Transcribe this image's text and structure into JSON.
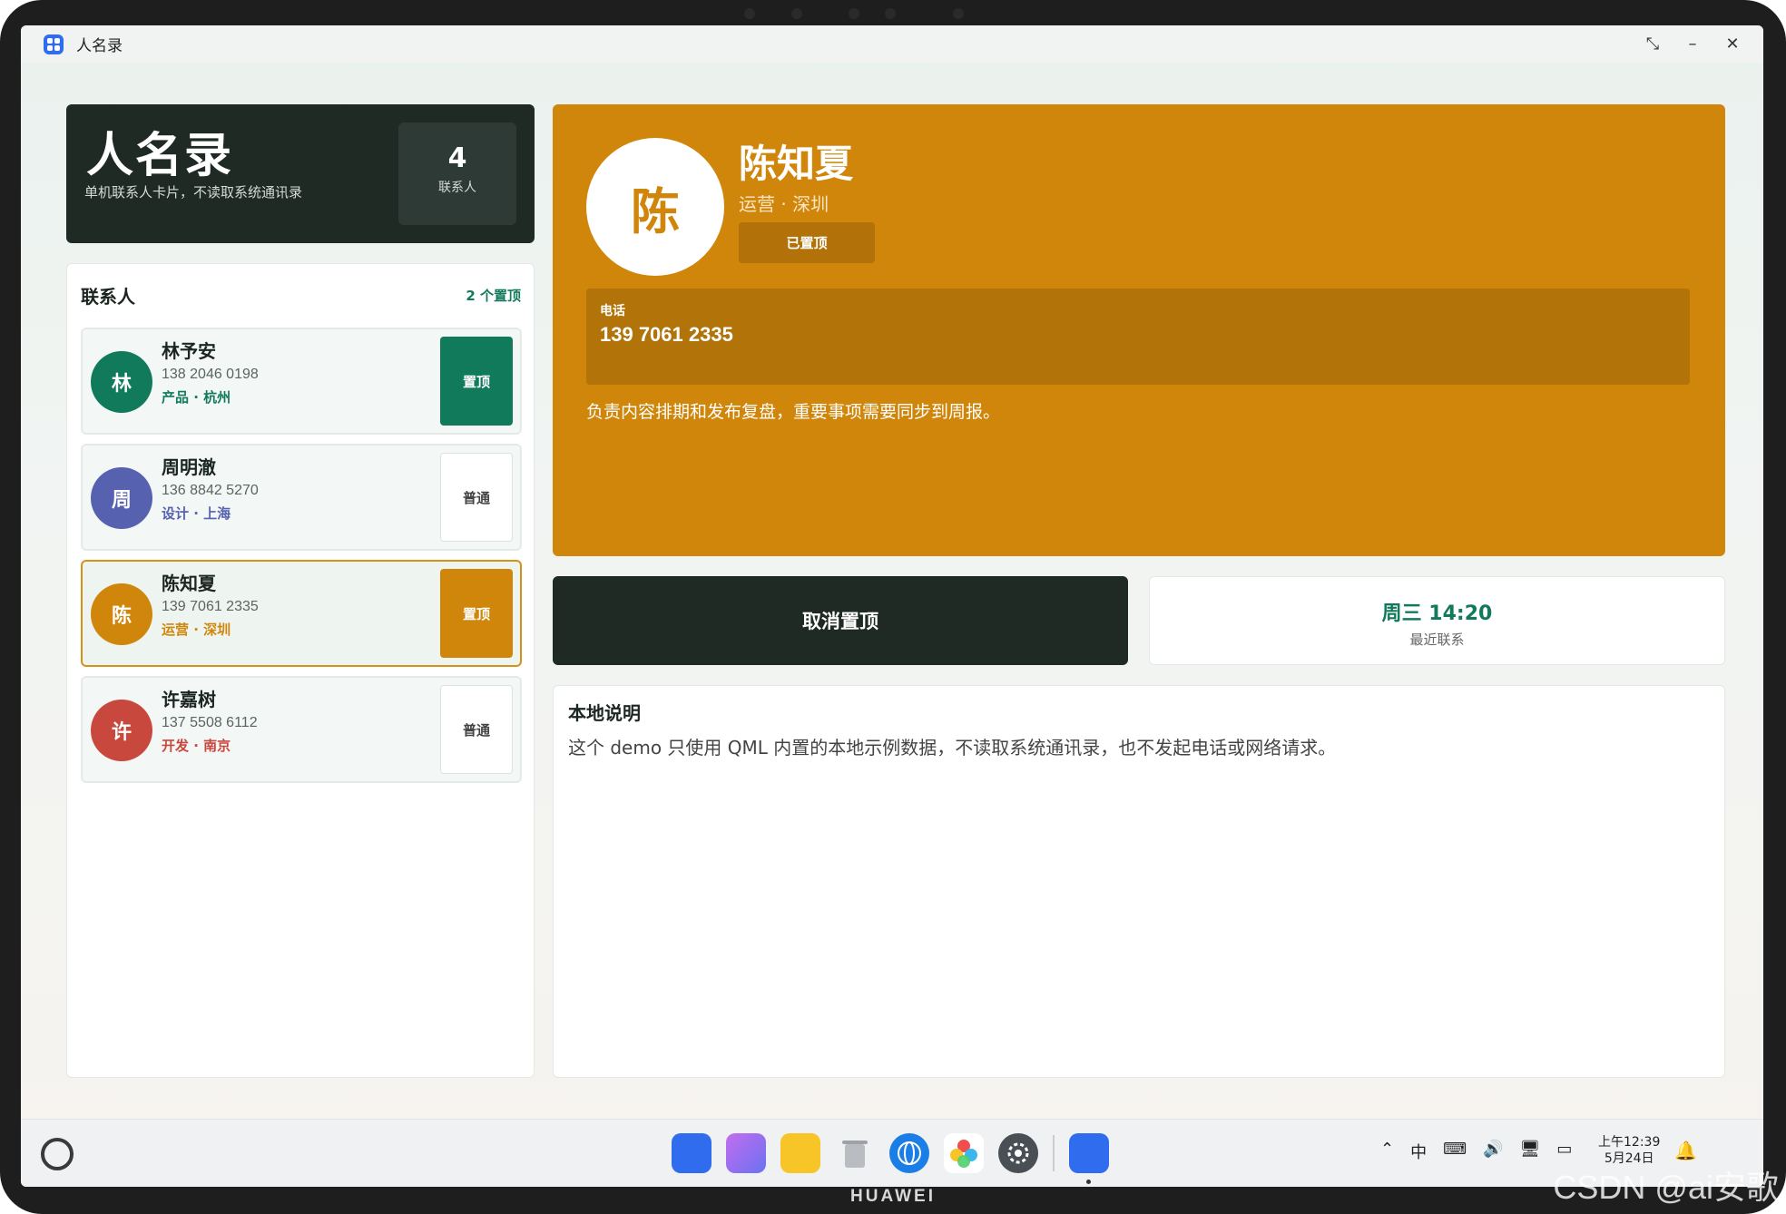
{
  "window": {
    "title": "人名录"
  },
  "hero": {
    "title": "人名录",
    "subtitle": "单机联系人卡片，不读取系统通讯录",
    "count": "4",
    "count_label": "联系人"
  },
  "contacts": {
    "heading": "联系人",
    "pinned_summary": "2 个置顶",
    "items": [
      {
        "initial": "林",
        "name": "林予安",
        "phone": "138 2046 0198",
        "meta": "产品 · 杭州",
        "pin_label": "置顶",
        "pinned": true,
        "color": "#107a5b"
      },
      {
        "initial": "周",
        "name": "周明澈",
        "phone": "136 8842 5270",
        "meta": "设计 · 上海",
        "pin_label": "普通",
        "pinned": false,
        "color": "#5661b0"
      },
      {
        "initial": "陈",
        "name": "陈知夏",
        "phone": "139 7061 2335",
        "meta": "运营 · 深圳",
        "pin_label": "置顶",
        "pinned": true,
        "color": "#cf860b"
      },
      {
        "initial": "许",
        "name": "许嘉树",
        "phone": "137 5508 6112",
        "meta": "开发 · 南京",
        "pin_label": "普通",
        "pinned": false,
        "color": "#c9483e"
      }
    ]
  },
  "detail": {
    "initial": "陈",
    "name": "陈知夏",
    "meta": "运营 · 深圳",
    "pinned_label": "已置顶",
    "phone_label": "电话",
    "phone": "139 7061 2335",
    "note": "负责内容排期和发布复盘，重要事项需要同步到周报。",
    "accent": "#cf860b"
  },
  "actions": {
    "unpin_label": "取消置顶",
    "recent_value": "周三 14:20",
    "recent_label": "最近联系"
  },
  "notes": {
    "title": "本地说明",
    "body": "这个 demo 只使用 QML 内置的本地示例数据，不读取系统通讯录，也不发起电话或网络请求。"
  },
  "taskbar": {
    "dock_icons": [
      "app-grid-icon",
      "multi-window-icon",
      "files-icon",
      "trash-icon",
      "browser-icon",
      "gallery-icon",
      "settings-icon",
      "name-directory-app-icon"
    ],
    "ime": "中",
    "time": "上午12:39",
    "date": "5月24日"
  },
  "device": {
    "brand": "HUAWEI",
    "watermark": "CSDN @ai安歌"
  }
}
